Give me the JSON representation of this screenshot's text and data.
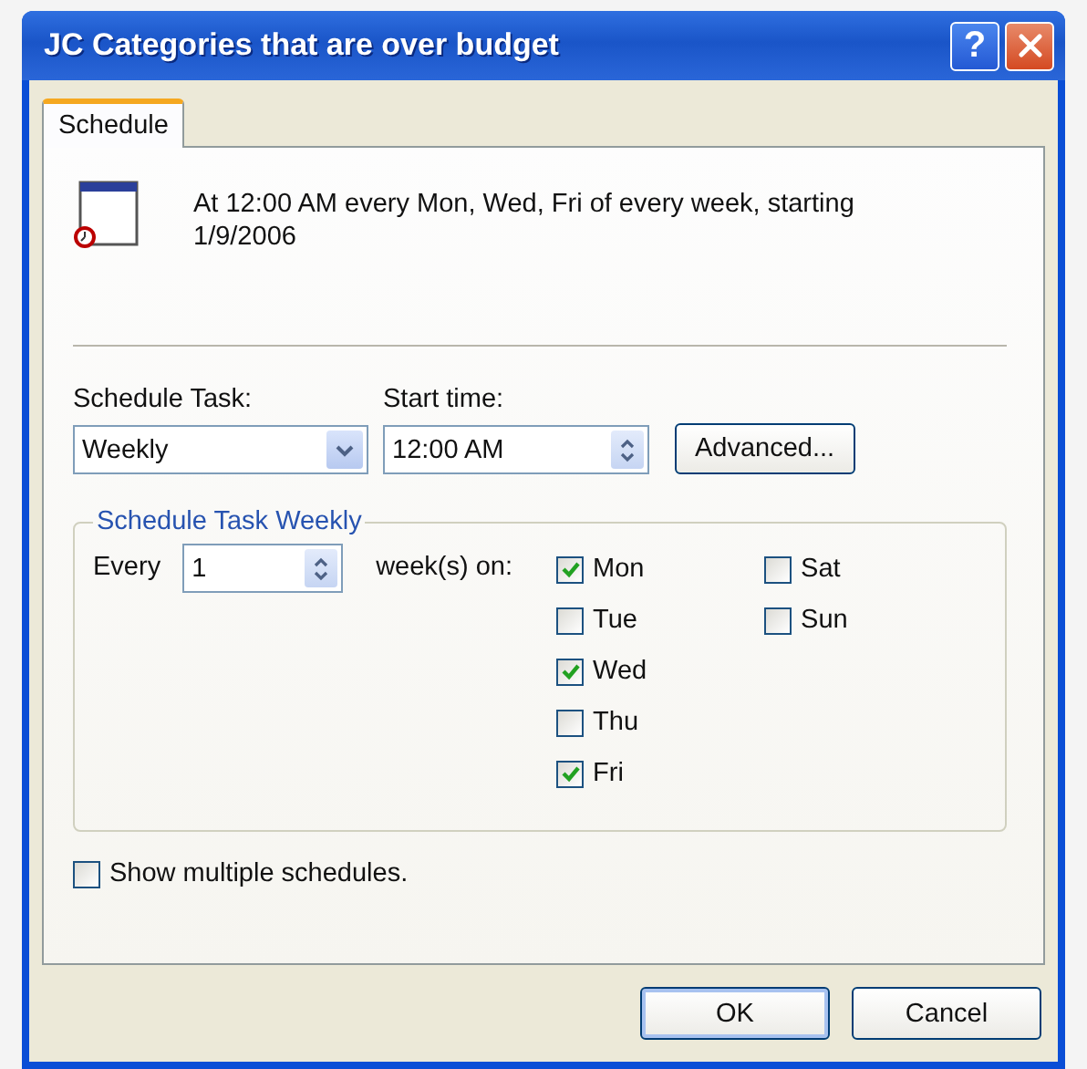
{
  "window": {
    "title": "JC Categories that are over budget",
    "help_button": "?"
  },
  "tabs": [
    {
      "label": "Schedule",
      "selected": true
    }
  ],
  "summary": "At 12:00 AM every Mon, Wed, Fri of every week, starting 1/9/2006",
  "schedule_task": {
    "label": "Schedule Task:",
    "value": "Weekly"
  },
  "start_time": {
    "label": "Start time:",
    "value": "12:00 AM"
  },
  "advanced_button": "Advanced...",
  "weekly_group": {
    "title": "Schedule Task Weekly",
    "every_label": "Every",
    "every_value": "1",
    "weeks_label": "week(s) on:",
    "days": [
      {
        "label": "Mon",
        "checked": true
      },
      {
        "label": "Tue",
        "checked": false
      },
      {
        "label": "Wed",
        "checked": true
      },
      {
        "label": "Thu",
        "checked": false
      },
      {
        "label": "Fri",
        "checked": true
      },
      {
        "label": "Sat",
        "checked": false
      },
      {
        "label": "Sun",
        "checked": false
      }
    ]
  },
  "show_multiple": {
    "label": "Show multiple schedules.",
    "checked": false
  },
  "buttons": [
    {
      "label": "OK",
      "kind": "default"
    },
    {
      "label": "Cancel",
      "kind": "normal"
    }
  ]
}
